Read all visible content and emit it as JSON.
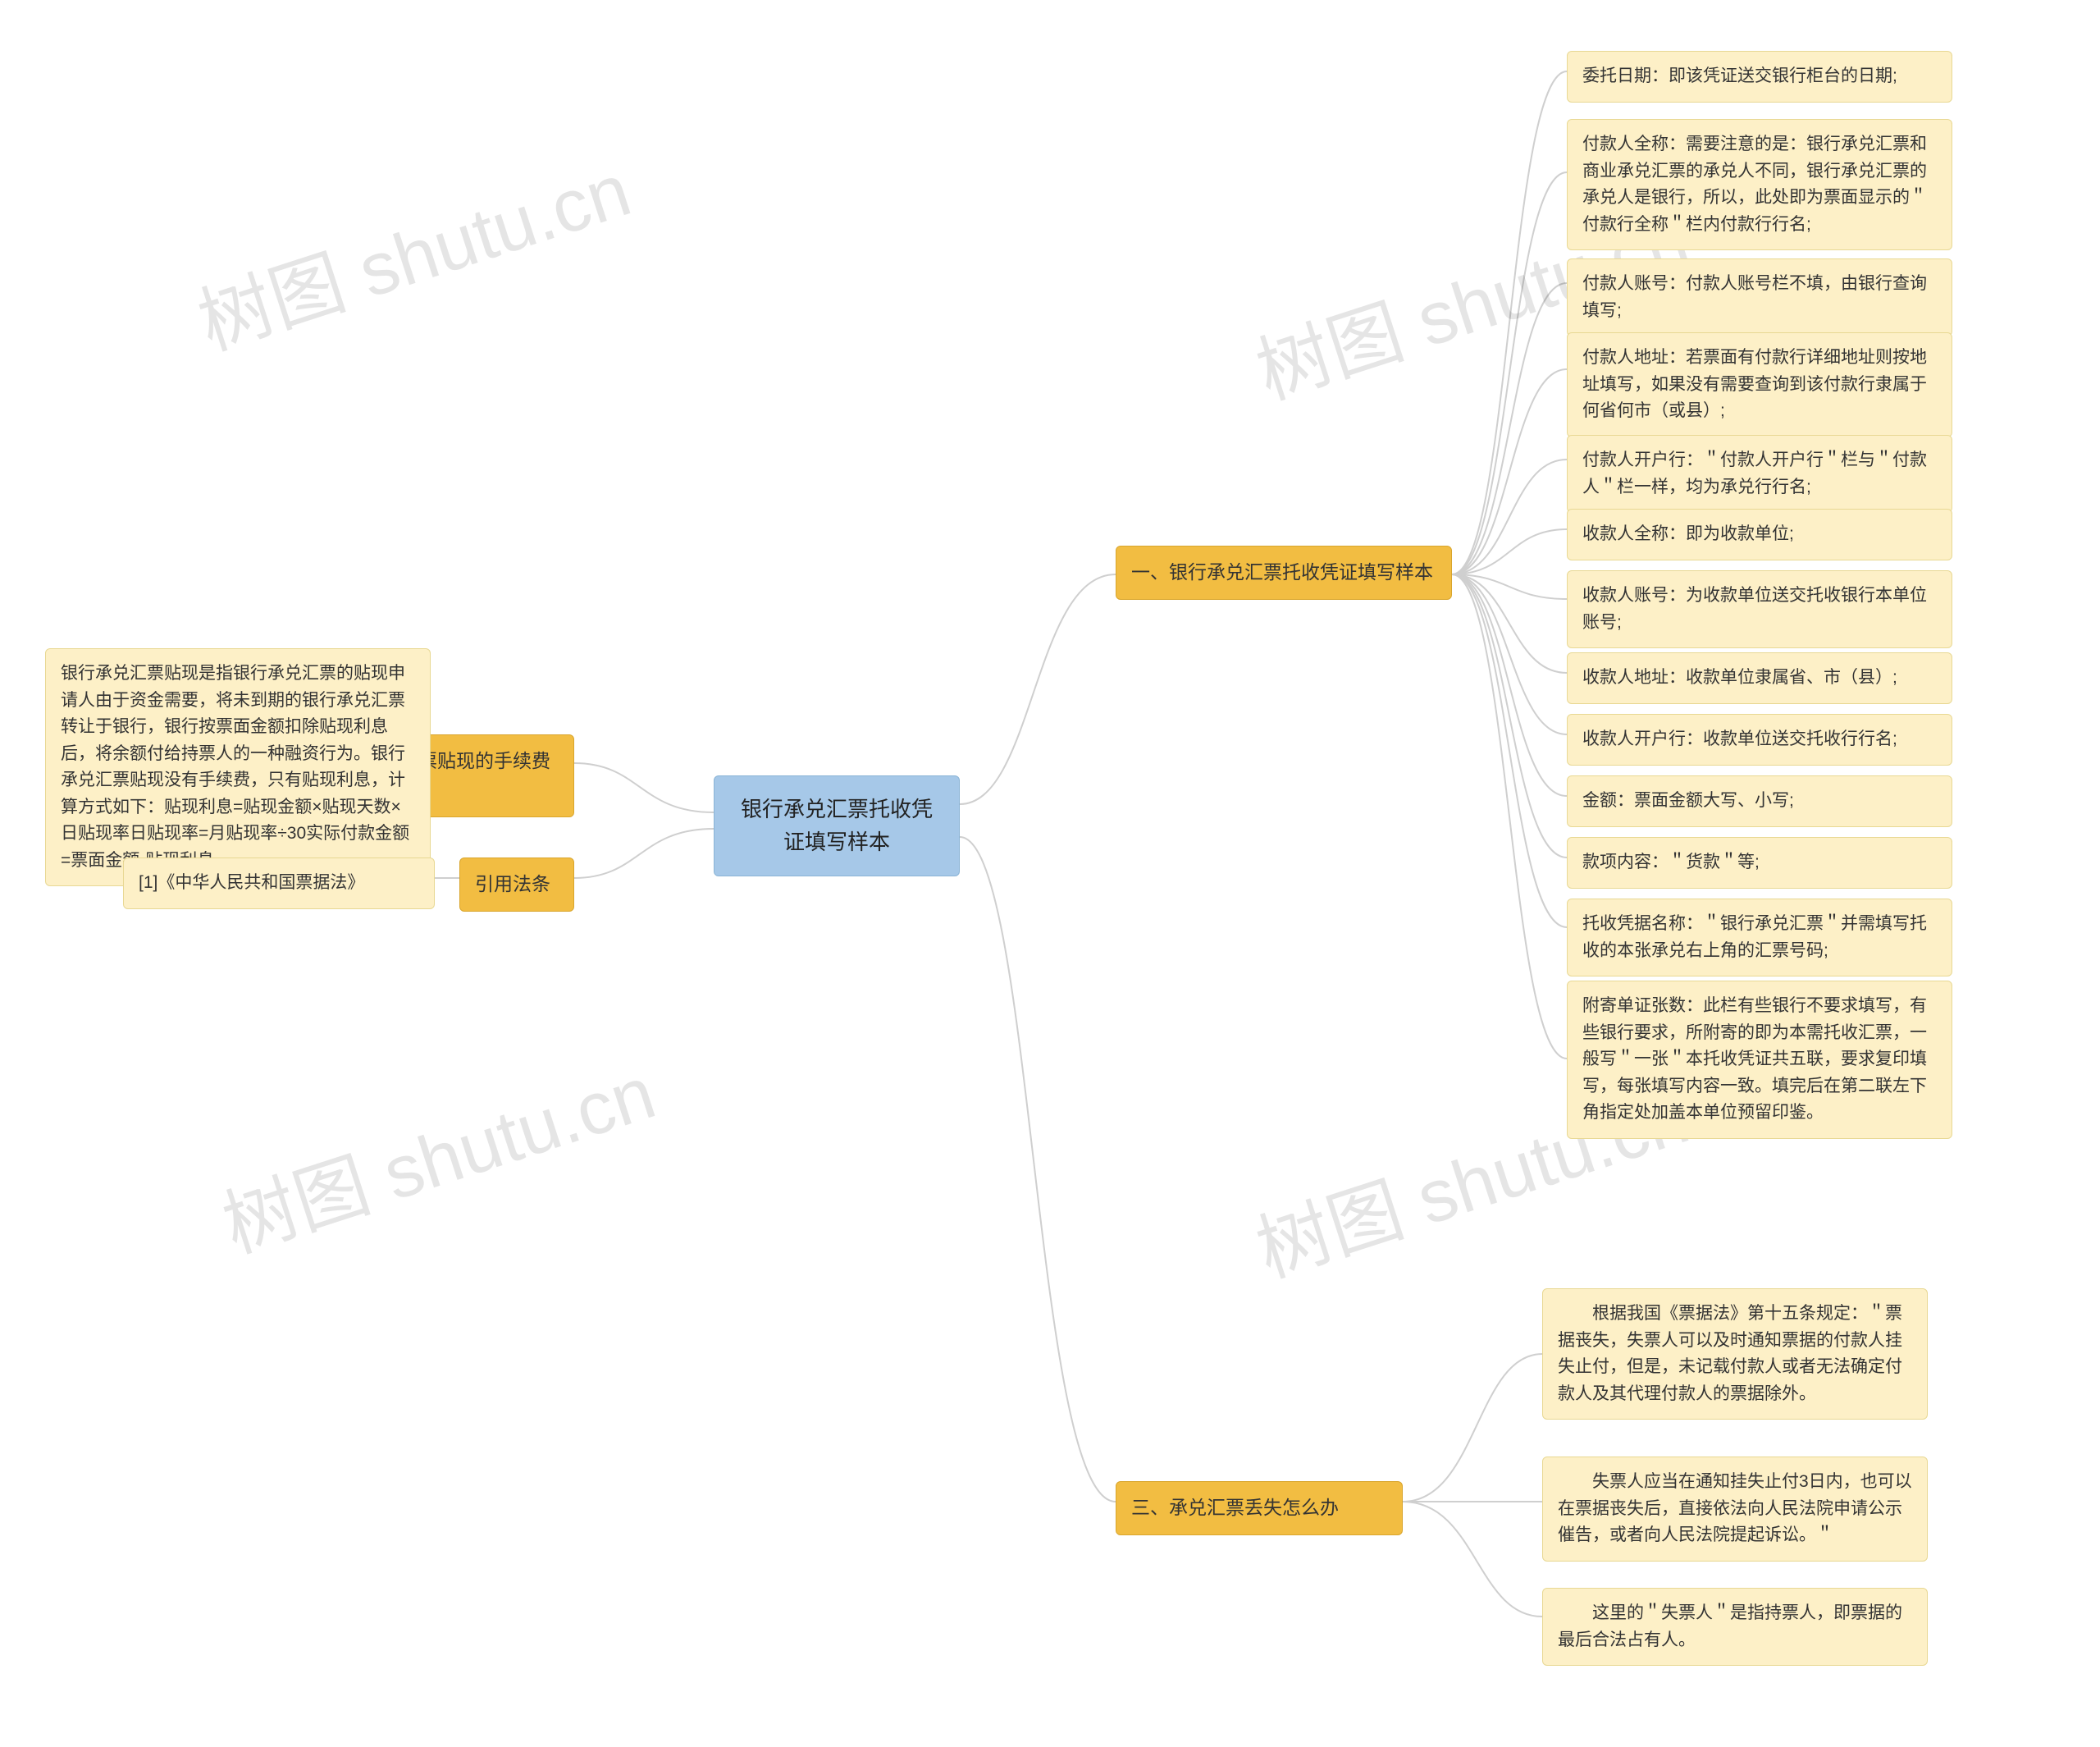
{
  "root": {
    "title": "银行承兑汇票托收凭证填写样本"
  },
  "branches": {
    "b1": {
      "title": "一、银行承兑汇票托收凭证填写样本"
    },
    "b2": {
      "title": "二、银行承兑汇票贴现的手续费是多少"
    },
    "b3": {
      "title": "三、承兑汇票丢失怎么办"
    },
    "b4": {
      "title": "引用法条"
    }
  },
  "leaves": {
    "l1": "委托日期：即该凭证送交银行柜台的日期;",
    "l2": "付款人全称：需要注意的是：银行承兑汇票和商业承兑汇票的承兑人不同，银行承兑汇票的承兑人是银行，所以，此处即为票面显示的＂付款行全称＂栏内付款行行名;",
    "l3": "付款人账号：付款人账号栏不填，由银行查询填写;",
    "l4": "付款人地址：若票面有付款行详细地址则按地址填写，如果没有需要查询到该付款行隶属于何省何市（或县）;",
    "l5": "付款人开户行：＂付款人开户行＂栏与＂付款人＂栏一样，均为承兑行行名;",
    "l6": "收款人全称：即为收款单位;",
    "l7": "收款人账号：为收款单位送交托收银行本单位账号;",
    "l8": "收款人地址：收款单位隶属省、市（县）;",
    "l9": "收款人开户行：收款单位送交托收行行名;",
    "l10": "金额：票面金额大写、小写;",
    "l11": "款项内容：＂货款＂等;",
    "l12": "托收凭据名称：＂银行承兑汇票＂并需填写托收的本张承兑右上角的汇票号码;",
    "l13": "附寄单证张数：此栏有些银行不要求填写，有些银行要求，所附寄的即为本需托收汇票，一般写＂一张＂本托收凭证共五联，要求复印填写，每张填写内容一致。填完后在第二联左下角指定处加盖本单位预留印鉴。",
    "l14": "　　根据我国《票据法》第十五条规定：＂票据丧失，失票人可以及时通知票据的付款人挂失止付，但是，未记载付款人或者无法确定付款人及其代理付款人的票据除外。",
    "l15": "　　失票人应当在通知挂失止付3日内，也可以在票据丧失后，直接依法向人民法院申请公示催告，或者向人民法院提起诉讼。＂",
    "l16": "　　这里的＂失票人＂是指持票人，即票据的最后合法占有人。",
    "l17": "银行承兑汇票贴现是指银行承兑汇票的贴现申请人由于资金需要，将未到期的银行承兑汇票转让于银行，银行按票面金额扣除贴现利息后，将余额付给持票人的一种融资行为。银行承兑汇票贴现没有手续费，只有贴现利息，计算方式如下：贴现利息=贴现金额×贴现天数×日贴现率日贴现率=月贴现率÷30实际付款金额=票面金额-贴现利息",
    "l18": "[1]《中华人民共和国票据法》"
  },
  "watermark": "树图 shutu.cn"
}
